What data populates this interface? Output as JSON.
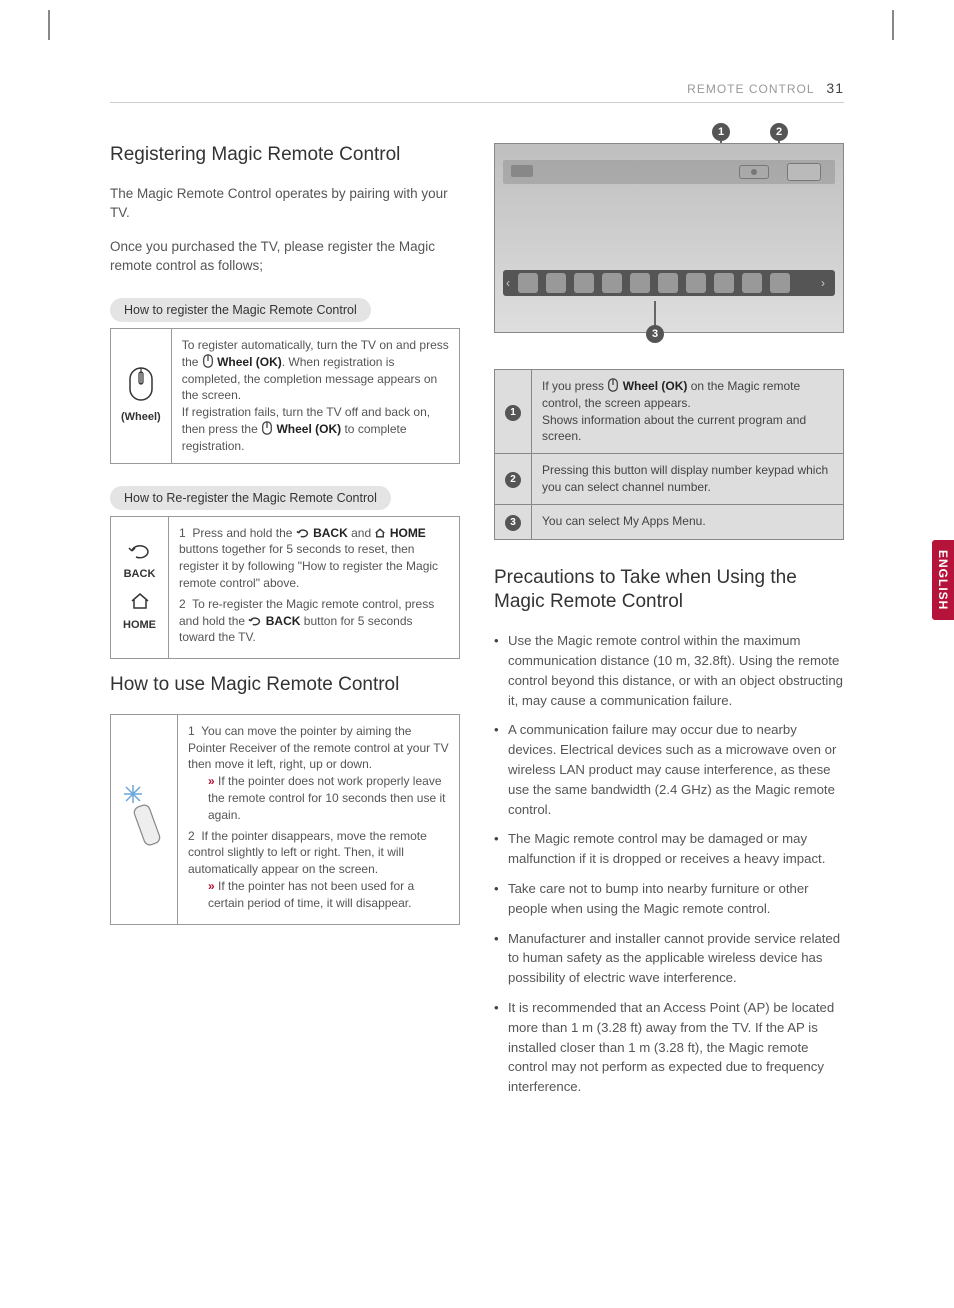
{
  "header": {
    "section": "REMOTE CONTROL",
    "page": "31"
  },
  "lang_tab": "ENGLISH",
  "left": {
    "h1": "Registering Magic Remote Control",
    "intro1": "The Magic Remote Control operates by pairing with your TV.",
    "intro2": "Once you purchased the TV, please register the Magic remote control as follows;",
    "pill1": "How to register the Magic Remote Control",
    "reg_icon_label": "(Wheel)",
    "reg_text_a": "To register automatically, turn the TV on and press the ",
    "reg_wheel_ok": "Wheel (OK)",
    "reg_text_b": ". When registration is completed, the completion message appears on the screen.",
    "reg_text_c": "If registration fails, turn the TV off and back on, then press the ",
    "reg_text_d": " to complete registration.",
    "pill2": "How to Re-register the Magic Remote Control",
    "rereg_back": "BACK",
    "rereg_home": "HOME",
    "rereg_1a": "Press and hold the ",
    "rereg_back_b": "BACK",
    "rereg_1b": " and ",
    "rereg_home_b": "HOME",
    "rereg_1c": " buttons together for 5 seconds to reset, then register it by following \"How to register the Magic remote control\" above.",
    "rereg_2a": "To re-register the Magic remote control, press and hold the ",
    "rereg_2b": " button for 5 seconds toward the TV.",
    "h2": "How to use Magic Remote Control",
    "use_1": "You can move the pointer by aiming the Pointer Receiver of the remote control at your TV then move it left, right, up or down.",
    "use_1_note_pref": "»",
    "use_1_note": "If the pointer does not work properly leave the remote control for 10 seconds then use it again.",
    "use_2": "If the pointer disappears, move the remote control slightly to left or right. Then, it will automatically appear on the screen.",
    "use_2_note": "If the pointer has not been used for a certain period of time, it will disappear."
  },
  "right": {
    "table": {
      "r1a": "If you press ",
      "r1_wheel": "Wheel (OK)",
      "r1b": " on the Magic remote control, the screen appears.",
      "r1c": "Shows information about the current program and screen.",
      "r2": "Pressing this button will display number keypad which you can select channel number.",
      "r3": "You can select My Apps Menu."
    },
    "h": "Precautions to Take when Using the Magic Remote Control",
    "bullets": [
      "Use the Magic remote control within the maximum communication distance (10 m, 32.8ft). Using the remote control beyond this distance, or with an object obstructing it, may cause a communication failure.",
      "A communication failure may occur due to nearby devices. Electrical devices such as a microwave oven or wireless LAN product may cause interference, as these use the same bandwidth (2.4 GHz) as the Magic remote control.",
      "The Magic remote control may be damaged or may malfunction if it is dropped or receives a heavy impact.",
      "Take care not to bump into nearby furniture or other people when using the Magic remote control.",
      "Manufacturer and installer cannot provide service related to human safety as the applicable wireless device has possibility of electric wave interference.",
      "It is recommended that an Access Point (AP) be located more than 1 m (3.28 ft) away from the TV. If the AP is installed closer than 1 m (3.28 ft), the Magic remote control may not perform as expected due to frequency interference."
    ]
  }
}
